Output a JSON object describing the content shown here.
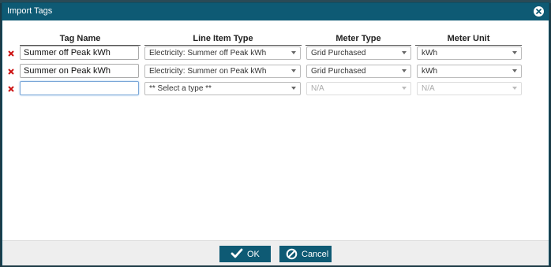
{
  "dialog": {
    "title": "Import Tags"
  },
  "headers": {
    "tag_name": "Tag Name",
    "line_item_type": "Line Item Type",
    "meter_type": "Meter Type",
    "meter_unit": "Meter Unit"
  },
  "rows": [
    {
      "tag_name": "Summer off Peak kWh",
      "line_item_type": "Electricity: Summer off Peak kWh",
      "meter_type": "Grid Purchased",
      "meter_unit": "kWh"
    },
    {
      "tag_name": "Summer on Peak kWh",
      "line_item_type": "Electricity: Summer on Peak kWh",
      "meter_type": "Grid Purchased",
      "meter_unit": "kWh"
    },
    {
      "tag_name": "",
      "line_item_type": "** Select a type **",
      "meter_type": "N/A",
      "meter_unit": "N/A"
    }
  ],
  "buttons": {
    "ok": "OK",
    "cancel": "Cancel"
  },
  "colors": {
    "titlebar": "#0e5a74",
    "delete_x": "#cc1111",
    "button": "#0e5a74"
  },
  "icons": {
    "close": "close-circle-icon",
    "delete": "delete-x-icon",
    "ok": "checkmark-icon",
    "cancel": "cancel-circle-icon"
  }
}
